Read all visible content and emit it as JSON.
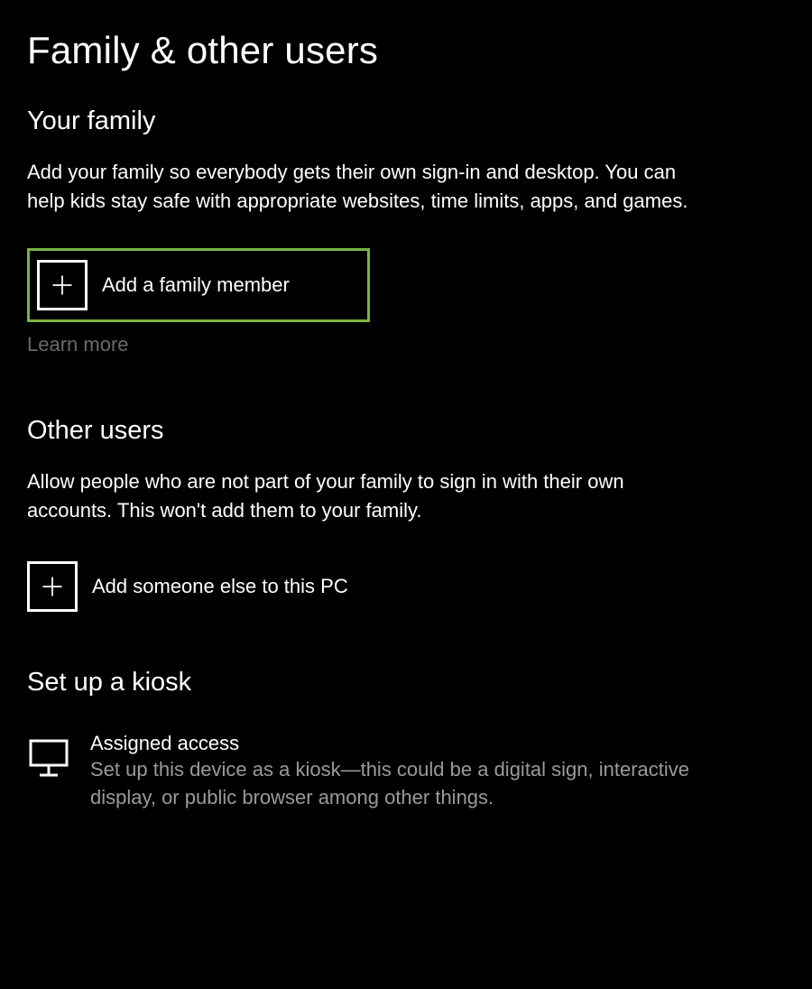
{
  "page_title": "Family & other users",
  "family": {
    "heading": "Your family",
    "description": "Add your family so everybody gets their own sign-in and desktop. You can help kids stay safe with appropriate websites, time limits, apps, and games.",
    "add_label": "Add a family member",
    "learn_more": "Learn more"
  },
  "other_users": {
    "heading": "Other users",
    "description": "Allow people who are not part of your family to sign in with their own accounts. This won't add them to your family.",
    "add_label": "Add someone else to this PC"
  },
  "kiosk": {
    "heading": "Set up a kiosk",
    "item_title": "Assigned access",
    "item_description": "Set up this device as a kiosk—this could be a digital sign, interactive display, or public browser among other things."
  },
  "colors": {
    "highlight_border": "#7cb342",
    "muted_text": "#9a9a9a",
    "disabled_link": "#6a6a6a"
  }
}
